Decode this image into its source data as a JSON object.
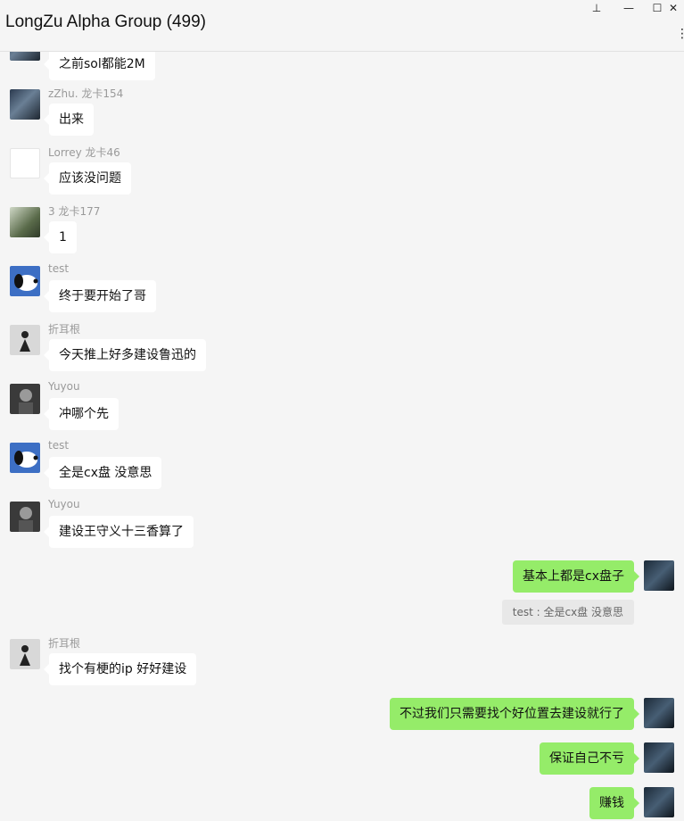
{
  "window": {
    "title": "LongZu Alpha Group (499)",
    "controls": {
      "pin": "⊥",
      "minimize": "—",
      "maximize": "☐",
      "close": "✕",
      "more": "·"
    }
  },
  "messages": [
    {
      "side": "left",
      "name": "",
      "text": "之前sol都能2M",
      "avatar": "photo-icon"
    },
    {
      "side": "left",
      "name": "zZhu. 龙卡154",
      "text": "出来",
      "avatar": "photo-icon"
    },
    {
      "side": "left",
      "name": "Lorrey 龙卡46",
      "text": "应该没问题",
      "avatar": "sketch-icon"
    },
    {
      "side": "left",
      "name": "3 龙卡177",
      "text": "1",
      "avatar": "anime-icon"
    },
    {
      "side": "left",
      "name": "test",
      "text": "终于要开始了哥",
      "avatar": "snoopy-icon"
    },
    {
      "side": "left",
      "name": "折耳根",
      "text": "今天推上好多建设鲁迅的",
      "avatar": "bw-figure-icon"
    },
    {
      "side": "left",
      "name": "Yuyou",
      "text": "冲哪个先",
      "avatar": "dark-figure-icon"
    },
    {
      "side": "left",
      "name": "test",
      "text": "全是cx盘 没意思",
      "avatar": "snoopy-icon"
    },
    {
      "side": "left",
      "name": "Yuyou",
      "text": "建设王守义十三香算了",
      "avatar": "dark-figure-icon"
    },
    {
      "side": "right",
      "text": "基本上都是cx盘子",
      "quote": "test : 全是cx盘 没意思",
      "avatar": "self-photo-icon"
    },
    {
      "side": "left",
      "name": "折耳根",
      "text": "找个有梗的ip 好好建设",
      "avatar": "bw-figure-icon"
    },
    {
      "side": "right",
      "text": "不过我们只需要找个好位置去建设就行了",
      "avatar": "self-photo-icon"
    },
    {
      "side": "right",
      "text": "保证自己不亏",
      "avatar": "self-photo-icon"
    },
    {
      "side": "right",
      "text": "赚钱",
      "avatar": "self-photo-icon"
    }
  ],
  "colors": {
    "background": "#f5f5f5",
    "incoming_bubble": "#ffffff",
    "outgoing_bubble": "#95ec69",
    "quote_bg": "#e8e8e8",
    "name_text": "#9a9a9a"
  }
}
